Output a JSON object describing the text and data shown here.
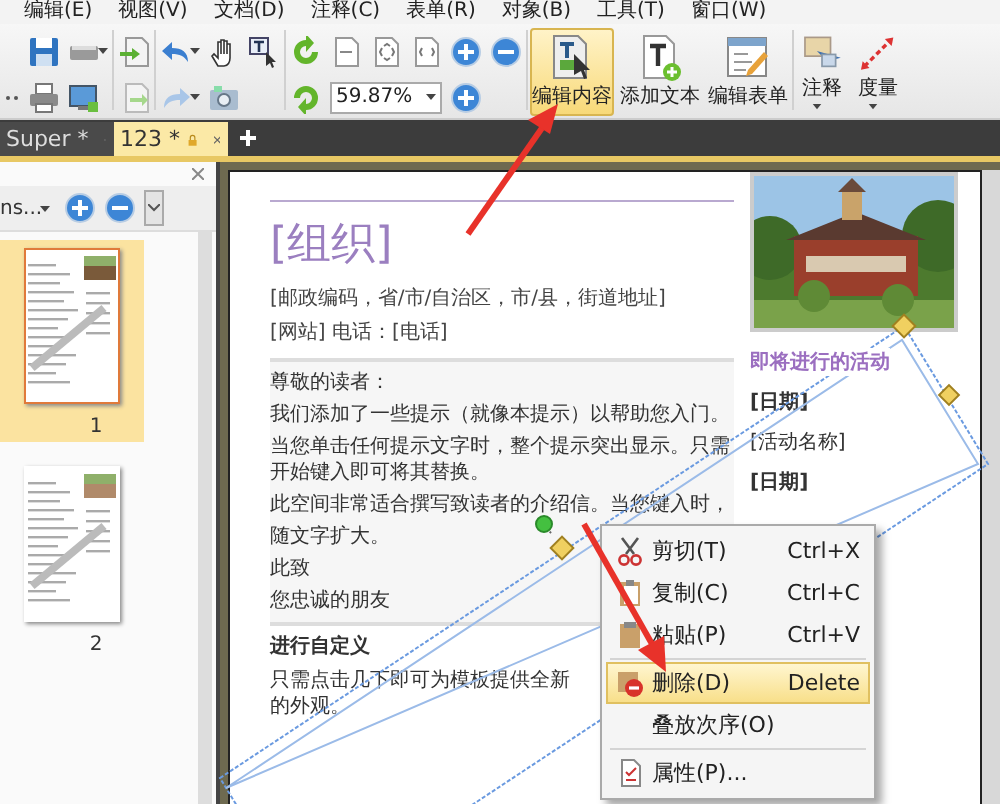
{
  "menu_bar": [
    "编辑(E)",
    "视图(V)",
    "文档(D)",
    "注释(C)",
    "表单(R)",
    "对象(B)",
    "工具(T)",
    "窗口(W)"
  ],
  "toolbar": {
    "zoom": {
      "value": "59.87%"
    },
    "buttons": [
      {
        "label": "编辑内容",
        "selected": true,
        "dropdown": false
      },
      {
        "label": "添加文本",
        "selected": false,
        "dropdown": false
      },
      {
        "label": "编辑表单",
        "selected": false,
        "dropdown": false
      },
      {
        "label": "注释",
        "selected": false,
        "dropdown": true
      },
      {
        "label": "度量",
        "selected": false,
        "dropdown": true
      }
    ]
  },
  "tabs": [
    {
      "label": "Super *",
      "selected": false,
      "locked": false
    },
    {
      "label": "123 *",
      "selected": true,
      "locked": true
    }
  ],
  "thumbnails_panel": {
    "view": "ns...",
    "pages": [
      {
        "label": "1",
        "selected": true
      },
      {
        "label": "2",
        "selected": false
      }
    ]
  },
  "document": {
    "title": "[组织]",
    "address": "[邮政编码，省/市/自治区，市/县，街道地址]",
    "contact": "[网站] 电话：[电话]",
    "body": [
      "尊敬的读者：",
      "我们添加了一些提示（就像本提示）以帮助您入门。",
      "当您单击任何提示文字时，整个提示突出显示。只需开始键入即可将其替换。",
      "此空间非常适合撰写致读者的介绍信。当您键入时，",
      "随文字扩大。",
      "此致",
      "您忠诚的朋友"
    ],
    "section_heading": "进行自定义",
    "section_text": "只需点击几下即可为模板提供全新的外观。",
    "sidebar": {
      "heading": "即将进行的活动",
      "items": [
        {
          "text": "[日期]",
          "bold": true
        },
        {
          "text": "[活动名称]",
          "bold": false
        },
        {
          "text": "[日期]",
          "bold": true
        }
      ]
    },
    "text_object": {
      "selected": true
    }
  },
  "context_menu": {
    "items": [
      {
        "label": "剪切(T)",
        "shortcut": "Ctrl+X",
        "selected": false,
        "separator_before": false
      },
      {
        "label": "复制(C)",
        "shortcut": "Ctrl+C",
        "selected": false,
        "separator_before": false
      },
      {
        "label": "粘贴(P)",
        "shortcut": "Ctrl+V",
        "selected": false,
        "separator_before": false
      },
      {
        "label": "删除(D)",
        "shortcut": "Delete",
        "selected": true,
        "separator_before": true
      },
      {
        "label": "叠放次序(O)",
        "selected": false,
        "separator_before": false
      },
      {
        "label": "属性(P)...",
        "selected": false,
        "separator_before": true
      }
    ]
  }
}
